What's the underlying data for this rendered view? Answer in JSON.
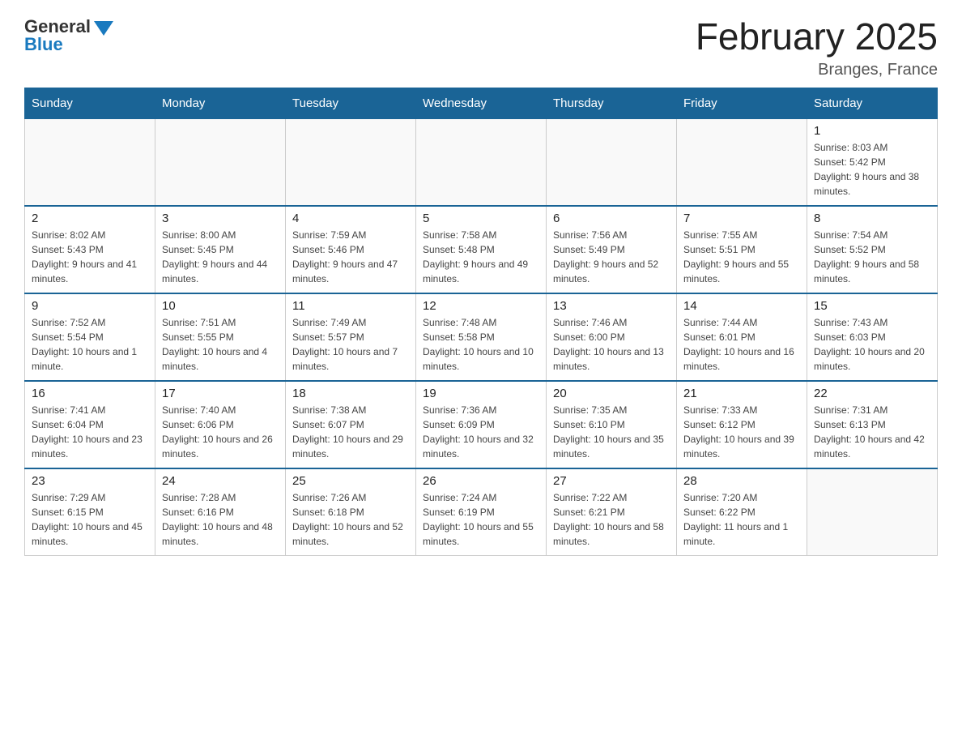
{
  "header": {
    "logo_general": "General",
    "logo_blue": "Blue",
    "month_title": "February 2025",
    "location": "Branges, France"
  },
  "weekdays": [
    "Sunday",
    "Monday",
    "Tuesday",
    "Wednesday",
    "Thursday",
    "Friday",
    "Saturday"
  ],
  "weeks": [
    [
      {
        "day": "",
        "info": ""
      },
      {
        "day": "",
        "info": ""
      },
      {
        "day": "",
        "info": ""
      },
      {
        "day": "",
        "info": ""
      },
      {
        "day": "",
        "info": ""
      },
      {
        "day": "",
        "info": ""
      },
      {
        "day": "1",
        "info": "Sunrise: 8:03 AM\nSunset: 5:42 PM\nDaylight: 9 hours and 38 minutes."
      }
    ],
    [
      {
        "day": "2",
        "info": "Sunrise: 8:02 AM\nSunset: 5:43 PM\nDaylight: 9 hours and 41 minutes."
      },
      {
        "day": "3",
        "info": "Sunrise: 8:00 AM\nSunset: 5:45 PM\nDaylight: 9 hours and 44 minutes."
      },
      {
        "day": "4",
        "info": "Sunrise: 7:59 AM\nSunset: 5:46 PM\nDaylight: 9 hours and 47 minutes."
      },
      {
        "day": "5",
        "info": "Sunrise: 7:58 AM\nSunset: 5:48 PM\nDaylight: 9 hours and 49 minutes."
      },
      {
        "day": "6",
        "info": "Sunrise: 7:56 AM\nSunset: 5:49 PM\nDaylight: 9 hours and 52 minutes."
      },
      {
        "day": "7",
        "info": "Sunrise: 7:55 AM\nSunset: 5:51 PM\nDaylight: 9 hours and 55 minutes."
      },
      {
        "day": "8",
        "info": "Sunrise: 7:54 AM\nSunset: 5:52 PM\nDaylight: 9 hours and 58 minutes."
      }
    ],
    [
      {
        "day": "9",
        "info": "Sunrise: 7:52 AM\nSunset: 5:54 PM\nDaylight: 10 hours and 1 minute."
      },
      {
        "day": "10",
        "info": "Sunrise: 7:51 AM\nSunset: 5:55 PM\nDaylight: 10 hours and 4 minutes."
      },
      {
        "day": "11",
        "info": "Sunrise: 7:49 AM\nSunset: 5:57 PM\nDaylight: 10 hours and 7 minutes."
      },
      {
        "day": "12",
        "info": "Sunrise: 7:48 AM\nSunset: 5:58 PM\nDaylight: 10 hours and 10 minutes."
      },
      {
        "day": "13",
        "info": "Sunrise: 7:46 AM\nSunset: 6:00 PM\nDaylight: 10 hours and 13 minutes."
      },
      {
        "day": "14",
        "info": "Sunrise: 7:44 AM\nSunset: 6:01 PM\nDaylight: 10 hours and 16 minutes."
      },
      {
        "day": "15",
        "info": "Sunrise: 7:43 AM\nSunset: 6:03 PM\nDaylight: 10 hours and 20 minutes."
      }
    ],
    [
      {
        "day": "16",
        "info": "Sunrise: 7:41 AM\nSunset: 6:04 PM\nDaylight: 10 hours and 23 minutes."
      },
      {
        "day": "17",
        "info": "Sunrise: 7:40 AM\nSunset: 6:06 PM\nDaylight: 10 hours and 26 minutes."
      },
      {
        "day": "18",
        "info": "Sunrise: 7:38 AM\nSunset: 6:07 PM\nDaylight: 10 hours and 29 minutes."
      },
      {
        "day": "19",
        "info": "Sunrise: 7:36 AM\nSunset: 6:09 PM\nDaylight: 10 hours and 32 minutes."
      },
      {
        "day": "20",
        "info": "Sunrise: 7:35 AM\nSunset: 6:10 PM\nDaylight: 10 hours and 35 minutes."
      },
      {
        "day": "21",
        "info": "Sunrise: 7:33 AM\nSunset: 6:12 PM\nDaylight: 10 hours and 39 minutes."
      },
      {
        "day": "22",
        "info": "Sunrise: 7:31 AM\nSunset: 6:13 PM\nDaylight: 10 hours and 42 minutes."
      }
    ],
    [
      {
        "day": "23",
        "info": "Sunrise: 7:29 AM\nSunset: 6:15 PM\nDaylight: 10 hours and 45 minutes."
      },
      {
        "day": "24",
        "info": "Sunrise: 7:28 AM\nSunset: 6:16 PM\nDaylight: 10 hours and 48 minutes."
      },
      {
        "day": "25",
        "info": "Sunrise: 7:26 AM\nSunset: 6:18 PM\nDaylight: 10 hours and 52 minutes."
      },
      {
        "day": "26",
        "info": "Sunrise: 7:24 AM\nSunset: 6:19 PM\nDaylight: 10 hours and 55 minutes."
      },
      {
        "day": "27",
        "info": "Sunrise: 7:22 AM\nSunset: 6:21 PM\nDaylight: 10 hours and 58 minutes."
      },
      {
        "day": "28",
        "info": "Sunrise: 7:20 AM\nSunset: 6:22 PM\nDaylight: 11 hours and 1 minute."
      },
      {
        "day": "",
        "info": ""
      }
    ]
  ]
}
